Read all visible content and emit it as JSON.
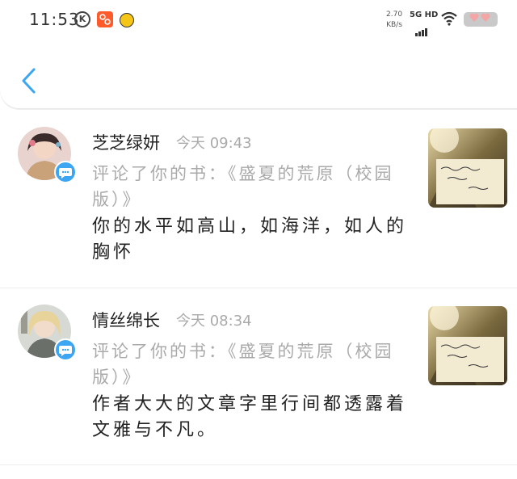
{
  "status_bar": {
    "time": "11:53",
    "k_icon": "K",
    "app_icon": "Soul",
    "net_speed_value": "2.70",
    "net_speed_unit": "KB/s",
    "network_type": "5G HD",
    "icons": [
      "k-circle-icon",
      "orange-app-icon",
      "bot-icon",
      "signal-icon",
      "wifi-icon",
      "battery-icon"
    ]
  },
  "header": {
    "back_icon": "chevron-left-icon"
  },
  "colors": {
    "accent": "#3da6f2",
    "muted_text": "#aaaaaa",
    "primary_text": "#222222"
  },
  "comments": [
    {
      "username": "芝芝绿妍",
      "time": "今天 09:43",
      "action": "评论了你的书：《盛夏的荒原（校园版）》",
      "text": "你的水平如高山，如海洋，如人的胸怀",
      "badge_icon": "comment-bubble-icon"
    },
    {
      "username": "情丝绵长",
      "time": "今天 08:34",
      "action": "评论了你的书：《盛夏的荒原（校园版）》",
      "text": "作者大大的文章字里行间都透露着文雅与不凡。",
      "badge_icon": "comment-bubble-icon"
    }
  ]
}
